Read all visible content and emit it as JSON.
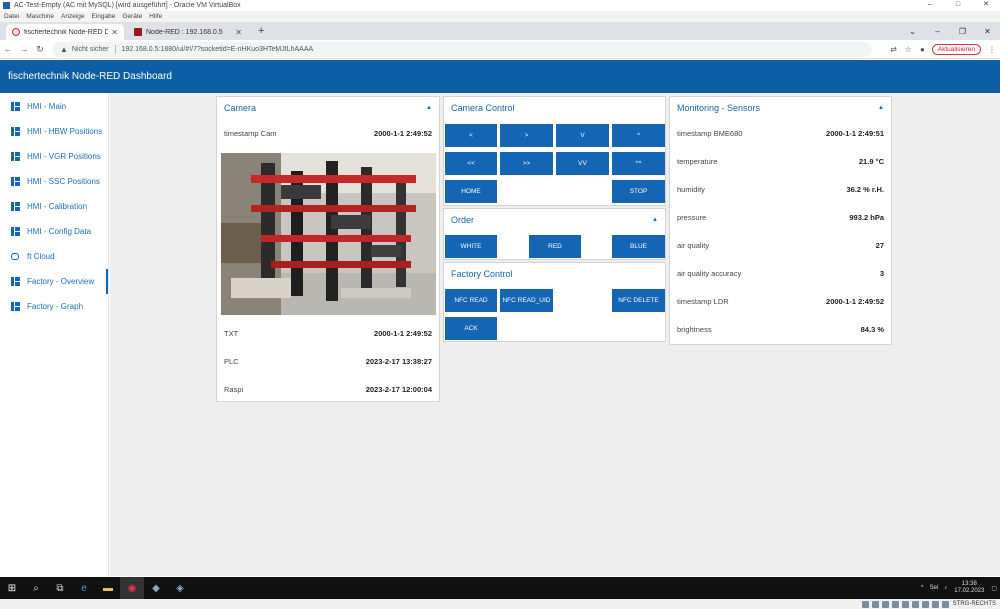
{
  "vbox": {
    "title": "AC-Test-Empty (AC mit MySQL) [wird ausgeführt] - Oracle VM VirtualBox",
    "menu": [
      "Datei",
      "Maschine",
      "Anzeige",
      "Eingabe",
      "Geräte",
      "Hilfe"
    ],
    "status_keyboard": "STRG-RECHTS"
  },
  "browser": {
    "tabs": [
      {
        "label": "fischertechnik Node-RED Dashb",
        "active": true
      },
      {
        "label": "Node-RED : 192.168.0.5",
        "active": false
      }
    ],
    "new_tab": "+",
    "security": "Nicht sicher",
    "url": "192.168.0.5:1880/ui/#!/7?socketid=E-nHKuo3HTeMJtLhAAAA",
    "update_button": "Aktualisieren"
  },
  "dashboard": {
    "title": "fischertechnik Node-RED Dashboard",
    "sidebar": [
      {
        "label": "HMI - Main",
        "icon": "dashboard-icon"
      },
      {
        "label": "HMI - HBW Positions",
        "icon": "dashboard-icon"
      },
      {
        "label": "HMI - VGR Positions",
        "icon": "dashboard-icon"
      },
      {
        "label": "HMI - SSC Positions",
        "icon": "dashboard-icon"
      },
      {
        "label": "HMI - Calibration",
        "icon": "dashboard-icon"
      },
      {
        "label": "HMI - Config Data",
        "icon": "dashboard-icon"
      },
      {
        "label": "ft Cloud",
        "icon": "cloud-icon"
      },
      {
        "label": "Factory - Overview",
        "icon": "dashboard-icon",
        "active": true
      },
      {
        "label": "Factory - Graph",
        "icon": "dashboard-icon"
      }
    ],
    "camera": {
      "title": "Camera",
      "timestamp_label": "timestamp Cam",
      "timestamp_value": "2000-1-1 2:49:52",
      "rows": [
        {
          "label": "TXT",
          "value": "2000-1-1 2:49:52"
        },
        {
          "label": "PLC",
          "value": "2023-2-17 13:38:27"
        },
        {
          "label": "Raspi",
          "value": "2023-2-17 12:00:04"
        }
      ]
    },
    "camera_control": {
      "title": "Camera Control",
      "buttons": [
        "<",
        ">",
        "V",
        "^",
        "<<",
        ">>",
        "VV",
        "^^",
        "HOME",
        "STOP"
      ]
    },
    "order": {
      "title": "Order",
      "buttons": [
        "WHITE",
        "RED",
        "BLUE"
      ]
    },
    "factory_control": {
      "title": "Factory Control",
      "buttons": [
        "NFC READ",
        "NFC READ_UID",
        "NFC DELETE",
        "ACK"
      ]
    },
    "monitoring": {
      "title": "Monitoring - Sensors",
      "rows": [
        {
          "label": "timestamp BME680",
          "value": "2000-1-1 2:49:51"
        },
        {
          "label": "temperature",
          "value": "21.9 °C"
        },
        {
          "label": "humidity",
          "value": "36.2 % r.H."
        },
        {
          "label": "pressure",
          "value": "993.2 hPa"
        },
        {
          "label": "air quality",
          "value": "27"
        },
        {
          "label": "air quality accuracy",
          "value": "3"
        },
        {
          "label": "timestamp LDR",
          "value": "2000-1-1 2:49:52"
        },
        {
          "label": "brightness",
          "value": "84.3 %"
        }
      ]
    }
  },
  "taskbar": {
    "time": "13:38",
    "date": "17.02.2023",
    "tray_lang": "Sei"
  },
  "colors": {
    "header": "#0e5ea6",
    "accent": "#1465b3",
    "panel_bg": "#eeeeee"
  }
}
